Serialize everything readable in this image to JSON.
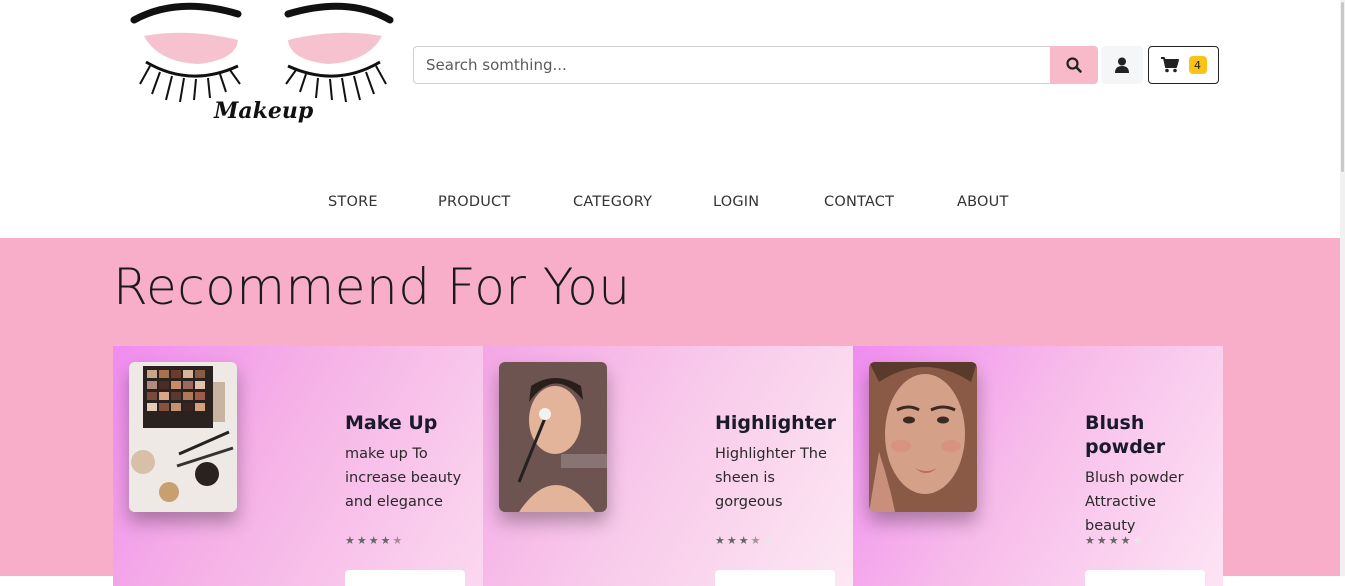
{
  "header": {
    "logo_text": "Makeup",
    "search_placeholder": "Search somthing...",
    "cart_count": "4",
    "icons": [
      "search-icon",
      "user-icon",
      "cart-icon"
    ]
  },
  "nav": {
    "items": [
      "STORE",
      "PRODUCT",
      "CATEGORY",
      "LOGIN",
      "CONTACT",
      "ABOUT"
    ]
  },
  "section": {
    "title": "Recommend For You"
  },
  "cards": [
    {
      "title": "Make Up",
      "description": "make up To increase beauty and elegance",
      "rating": 4.5,
      "image": "eyeshadow-palette-image"
    },
    {
      "title": "Highlighter",
      "description": "Highlighter The sheen is gorgeous",
      "rating": 3.5,
      "image": "woman-applying-highlighter-image"
    },
    {
      "title": "Blush powder",
      "description": "Blush powder Attractive beauty",
      "rating": 4,
      "image": "woman-with-blush-image"
    }
  ],
  "colors": {
    "section_bg": "#f8aec8",
    "search_button": "#f8b9c9",
    "cart_badge": "#fbc316"
  }
}
